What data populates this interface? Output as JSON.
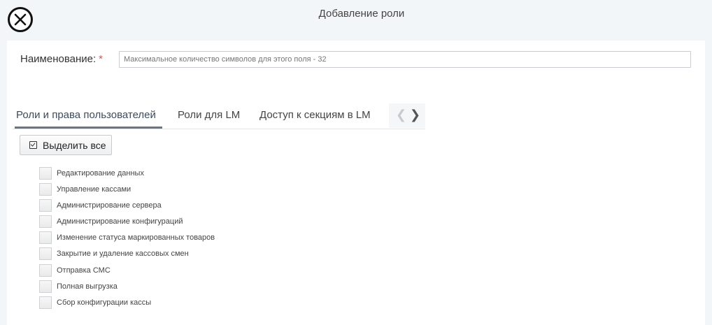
{
  "dialog": {
    "title": "Добавление роли",
    "close_icon": "close-circle-icon"
  },
  "name_field": {
    "label": "Наименование:",
    "required_mark": "*",
    "value": "",
    "placeholder": "Максимальное количество символов для этого поля - 32"
  },
  "tabs": [
    {
      "label": "Роли и права пользователей",
      "active": true
    },
    {
      "label": "Роли для LM",
      "active": false
    },
    {
      "label": "Доступ к секциям в LM",
      "active": false
    }
  ],
  "tab_scroll": {
    "prev_icon": "chevron-left-icon",
    "next_icon": "chevron-right-icon"
  },
  "select_all": {
    "label": "Выделить все",
    "icon": "checkbox-checked-icon"
  },
  "permissions": [
    {
      "label": "Редактирование данных",
      "checked": false
    },
    {
      "label": "Управление кассами",
      "checked": false
    },
    {
      "label": "Администрирование сервера",
      "checked": false
    },
    {
      "label": "Администрирование конфигураций",
      "checked": false
    },
    {
      "label": "Изменение статуса маркированных товаров",
      "checked": false
    },
    {
      "label": "Закрытие и удаление кассовых смен",
      "checked": false
    },
    {
      "label": "Отправка СМС",
      "checked": false
    },
    {
      "label": "Полная выгрузка",
      "checked": false
    },
    {
      "label": "Сбор конфигурации кассы",
      "checked": false
    }
  ]
}
